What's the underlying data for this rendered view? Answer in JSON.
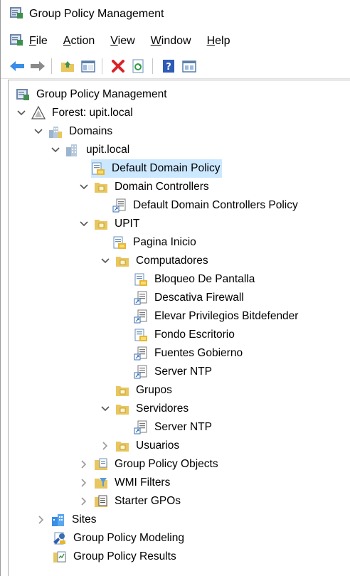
{
  "window": {
    "title": "Group Policy Management"
  },
  "menu": {
    "items": [
      {
        "label": "File",
        "underline": "F",
        "rest": "ile"
      },
      {
        "label": "Action",
        "underline": "A",
        "rest": "ction"
      },
      {
        "label": "View",
        "underline": "V",
        "rest": "iew"
      },
      {
        "label": "Window",
        "underline": "W",
        "rest": "indow"
      },
      {
        "label": "Help",
        "underline": "H",
        "rest": "elp"
      }
    ]
  },
  "toolbar": {
    "buttons": [
      "back-arrow-icon",
      "forward-arrow-icon",
      "up-folder-icon",
      "show-hide-tree-icon",
      "delete-icon",
      "refresh-icon",
      "help-icon",
      "properties-icon"
    ]
  },
  "tree": {
    "items": [
      {
        "label": "Group Policy Management",
        "depth": 0,
        "expander": "none",
        "icon": "gpm-root-icon"
      },
      {
        "label": "Forest: upit.local",
        "depth": 0,
        "expander": "expanded",
        "icon": "forest-icon"
      },
      {
        "label": "Domains",
        "depth": 1,
        "expander": "expanded",
        "icon": "domains-icon"
      },
      {
        "label": "upit.local",
        "depth": 2,
        "expander": "expanded",
        "icon": "domain-icon"
      },
      {
        "label": "Default Domain Policy",
        "depth": 3,
        "expander": "none",
        "icon": "gpo-link-icon",
        "selected": true
      },
      {
        "label": "Domain Controllers",
        "depth": 3,
        "expander": "expanded",
        "icon": "ou-folder-icon"
      },
      {
        "label": "Default Domain Controllers Policy",
        "depth": 4,
        "expander": "none",
        "icon": "gpo-script-icon"
      },
      {
        "label": "UPIT",
        "depth": 3,
        "expander": "expanded",
        "icon": "ou-folder-icon"
      },
      {
        "label": "Pagina Inicio",
        "depth": 4,
        "expander": "none",
        "icon": "gpo-link-icon"
      },
      {
        "label": "Computadores",
        "depth": 4,
        "expander": "expanded",
        "icon": "ou-folder-icon"
      },
      {
        "label": "Bloqueo De Pantalla",
        "depth": 5,
        "expander": "none",
        "icon": "gpo-link-icon"
      },
      {
        "label": "Descativa Firewall",
        "depth": 5,
        "expander": "none",
        "icon": "gpo-script-icon"
      },
      {
        "label": "Elevar Privilegios Bitdefender",
        "depth": 5,
        "expander": "none",
        "icon": "gpo-script-icon"
      },
      {
        "label": "Fondo Escritorio",
        "depth": 5,
        "expander": "none",
        "icon": "gpo-link-icon"
      },
      {
        "label": "Fuentes Gobierno",
        "depth": 5,
        "expander": "none",
        "icon": "gpo-script-icon"
      },
      {
        "label": "Server NTP",
        "depth": 5,
        "expander": "none",
        "icon": "gpo-script-icon"
      },
      {
        "label": "Grupos",
        "depth": 4,
        "expander": "none",
        "icon": "ou-folder-icon"
      },
      {
        "label": "Servidores",
        "depth": 4,
        "expander": "expanded",
        "icon": "ou-folder-icon"
      },
      {
        "label": "Server NTP",
        "depth": 5,
        "expander": "none",
        "icon": "gpo-script-icon"
      },
      {
        "label": "Usuarios",
        "depth": 4,
        "expander": "collapsed",
        "icon": "ou-folder-icon"
      },
      {
        "label": "Group Policy Objects",
        "depth": 3,
        "expander": "collapsed",
        "icon": "gpo-container-icon"
      },
      {
        "label": "WMI Filters",
        "depth": 3,
        "expander": "collapsed",
        "icon": "wmi-filter-icon"
      },
      {
        "label": "Starter GPOs",
        "depth": 3,
        "expander": "collapsed",
        "icon": "starter-gpo-icon"
      },
      {
        "label": "Sites",
        "depth": 1,
        "expander": "collapsed",
        "icon": "sites-icon"
      },
      {
        "label": "Group Policy Modeling",
        "depth": 2,
        "expander": "none",
        "icon": "modeling-icon"
      },
      {
        "label": "Group Policy Results",
        "depth": 2,
        "expander": "none",
        "icon": "results-icon"
      }
    ]
  },
  "colors": {
    "selection": "#cce8ff",
    "folder": "#e8c660",
    "arrow_blue": "#3a8ee6",
    "delete_red": "#d9232a"
  }
}
